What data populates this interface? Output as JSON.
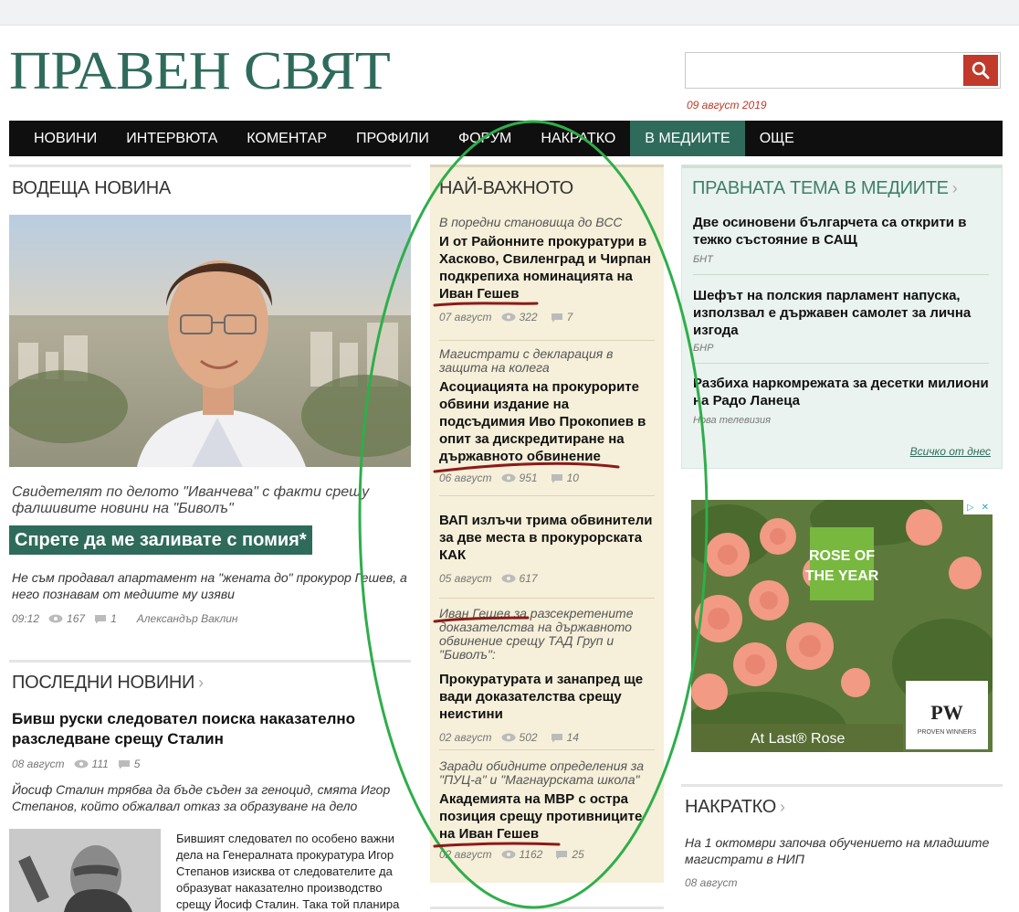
{
  "site": {
    "logo_text": "ПРАВЕН СВЯТ",
    "date": "09 август 2019",
    "search_placeholder": ""
  },
  "nav": {
    "items": [
      {
        "label": "НОВИНИ"
      },
      {
        "label": "ИНТЕРВЮТА"
      },
      {
        "label": "КОМЕНТАР"
      },
      {
        "label": "ПРОФИЛИ"
      },
      {
        "label": "ФОРУМ"
      },
      {
        "label": "НАКРАТКО"
      },
      {
        "label": "В МЕДИИТЕ"
      },
      {
        "label": "ОЩЕ"
      }
    ],
    "active": "В МЕДИИТЕ"
  },
  "lead": {
    "section": "ВОДЕЩА НОВИНА",
    "kicker": "Свидетелят по делото \"Иванчева\" с факти срещу фалшивите новини на \"Биволъ\"",
    "title": "Спрете да ме заливате с помия*",
    "desc": "Не съм продавал апартамент на \"жената до\" прокурор Гешев, а него познавам от медиите му изяви",
    "time": "09:12",
    "views": "167",
    "comments": "1",
    "author": "Александър Ваклин"
  },
  "important": {
    "section": "НАЙ-ВАЖНОТО",
    "items": [
      {
        "kicker": "В поредни становища до ВСС",
        "title": "И от Районните прокуратури в Хасково, Свиленград и Чирпан подкрепиха номинацията на Иван Гешев",
        "date": "07 август",
        "views": "322",
        "comments": "7"
      },
      {
        "kicker": "Магистрати с декларация в защита на колега",
        "title": "Асоциацията на прокурорите обвини издание на подсъдимия Иво Прокопиев в опит за дискредитиране на държавното обвинение",
        "date": "06 август",
        "views": "951",
        "comments": "10"
      },
      {
        "kicker": "",
        "title": "ВАП излъчи трима обвинители за две места в прокурорската КАК",
        "date": "05 август",
        "views": "617",
        "comments": ""
      },
      {
        "kicker": "Иван Гешев за разсекретените доказателства на държавното обвинение срещу ТАД Груп и \"Биволъ\":",
        "title": "Прокуратурата и занапред ще вади доказателства срещу неистини",
        "date": "02 август",
        "views": "502",
        "comments": "14"
      },
      {
        "kicker": "Заради обидните определения за \"ПУЦ-а\" и \"Магнаурската школа\"",
        "title": "Академията на МВР с остра позиция срещу противниците на Иван Гешев",
        "date": "02 август",
        "views": "1162",
        "comments": "25"
      }
    ]
  },
  "media": {
    "section": "ПРАВНАТА ТЕМА В МЕДИИТЕ",
    "items": [
      {
        "title": "Две осиновени българчета са открити в тежко състояние в САЩ",
        "source": "БНТ"
      },
      {
        "title": "Шефът на полския парламент напуска, използвал е държавен самолет за лична изгода",
        "source": "БНР"
      },
      {
        "title": "Разбиха наркомрежата за десетки милиони на Радо Ланеца",
        "source": "Нова телевизия"
      }
    ],
    "all_link": "Всичко от днес"
  },
  "ad": {
    "badge1": "ROSE OF",
    "badge2": "THE YEAR",
    "caption": "At Last® Rose",
    "brand": "PW",
    "brand_sub": "PROVEN WINNERS"
  },
  "latest": {
    "section": "ПОСЛЕДНИ НОВИНИ",
    "title": "Бивш руски следовател поиска наказателно разследване срещу Сталин",
    "date": "08 август",
    "views": "111",
    "comments": "5",
    "desc": "Йосиф Сталин трябва да бъде съден за геноцид, смята Игор Степанов, който обжалвал отказ за образуване на дело",
    "body": "Бившият следовател по особено важни дела на Генералната прокуратура Игор Степанов изисква от следователите да образуват наказателно производство срещу Йосиф Сталин. Така той планира"
  },
  "brief": {
    "section": "НАКРАТКО",
    "title": "На 1 октомври започва обучението на младшите магистрати в НИП",
    "date": "08 август"
  },
  "colors": {
    "brand": "#2f6b5b",
    "accent": "#c0392b",
    "important_bg": "#f6efd9",
    "media_bg": "#eaf3ef"
  }
}
